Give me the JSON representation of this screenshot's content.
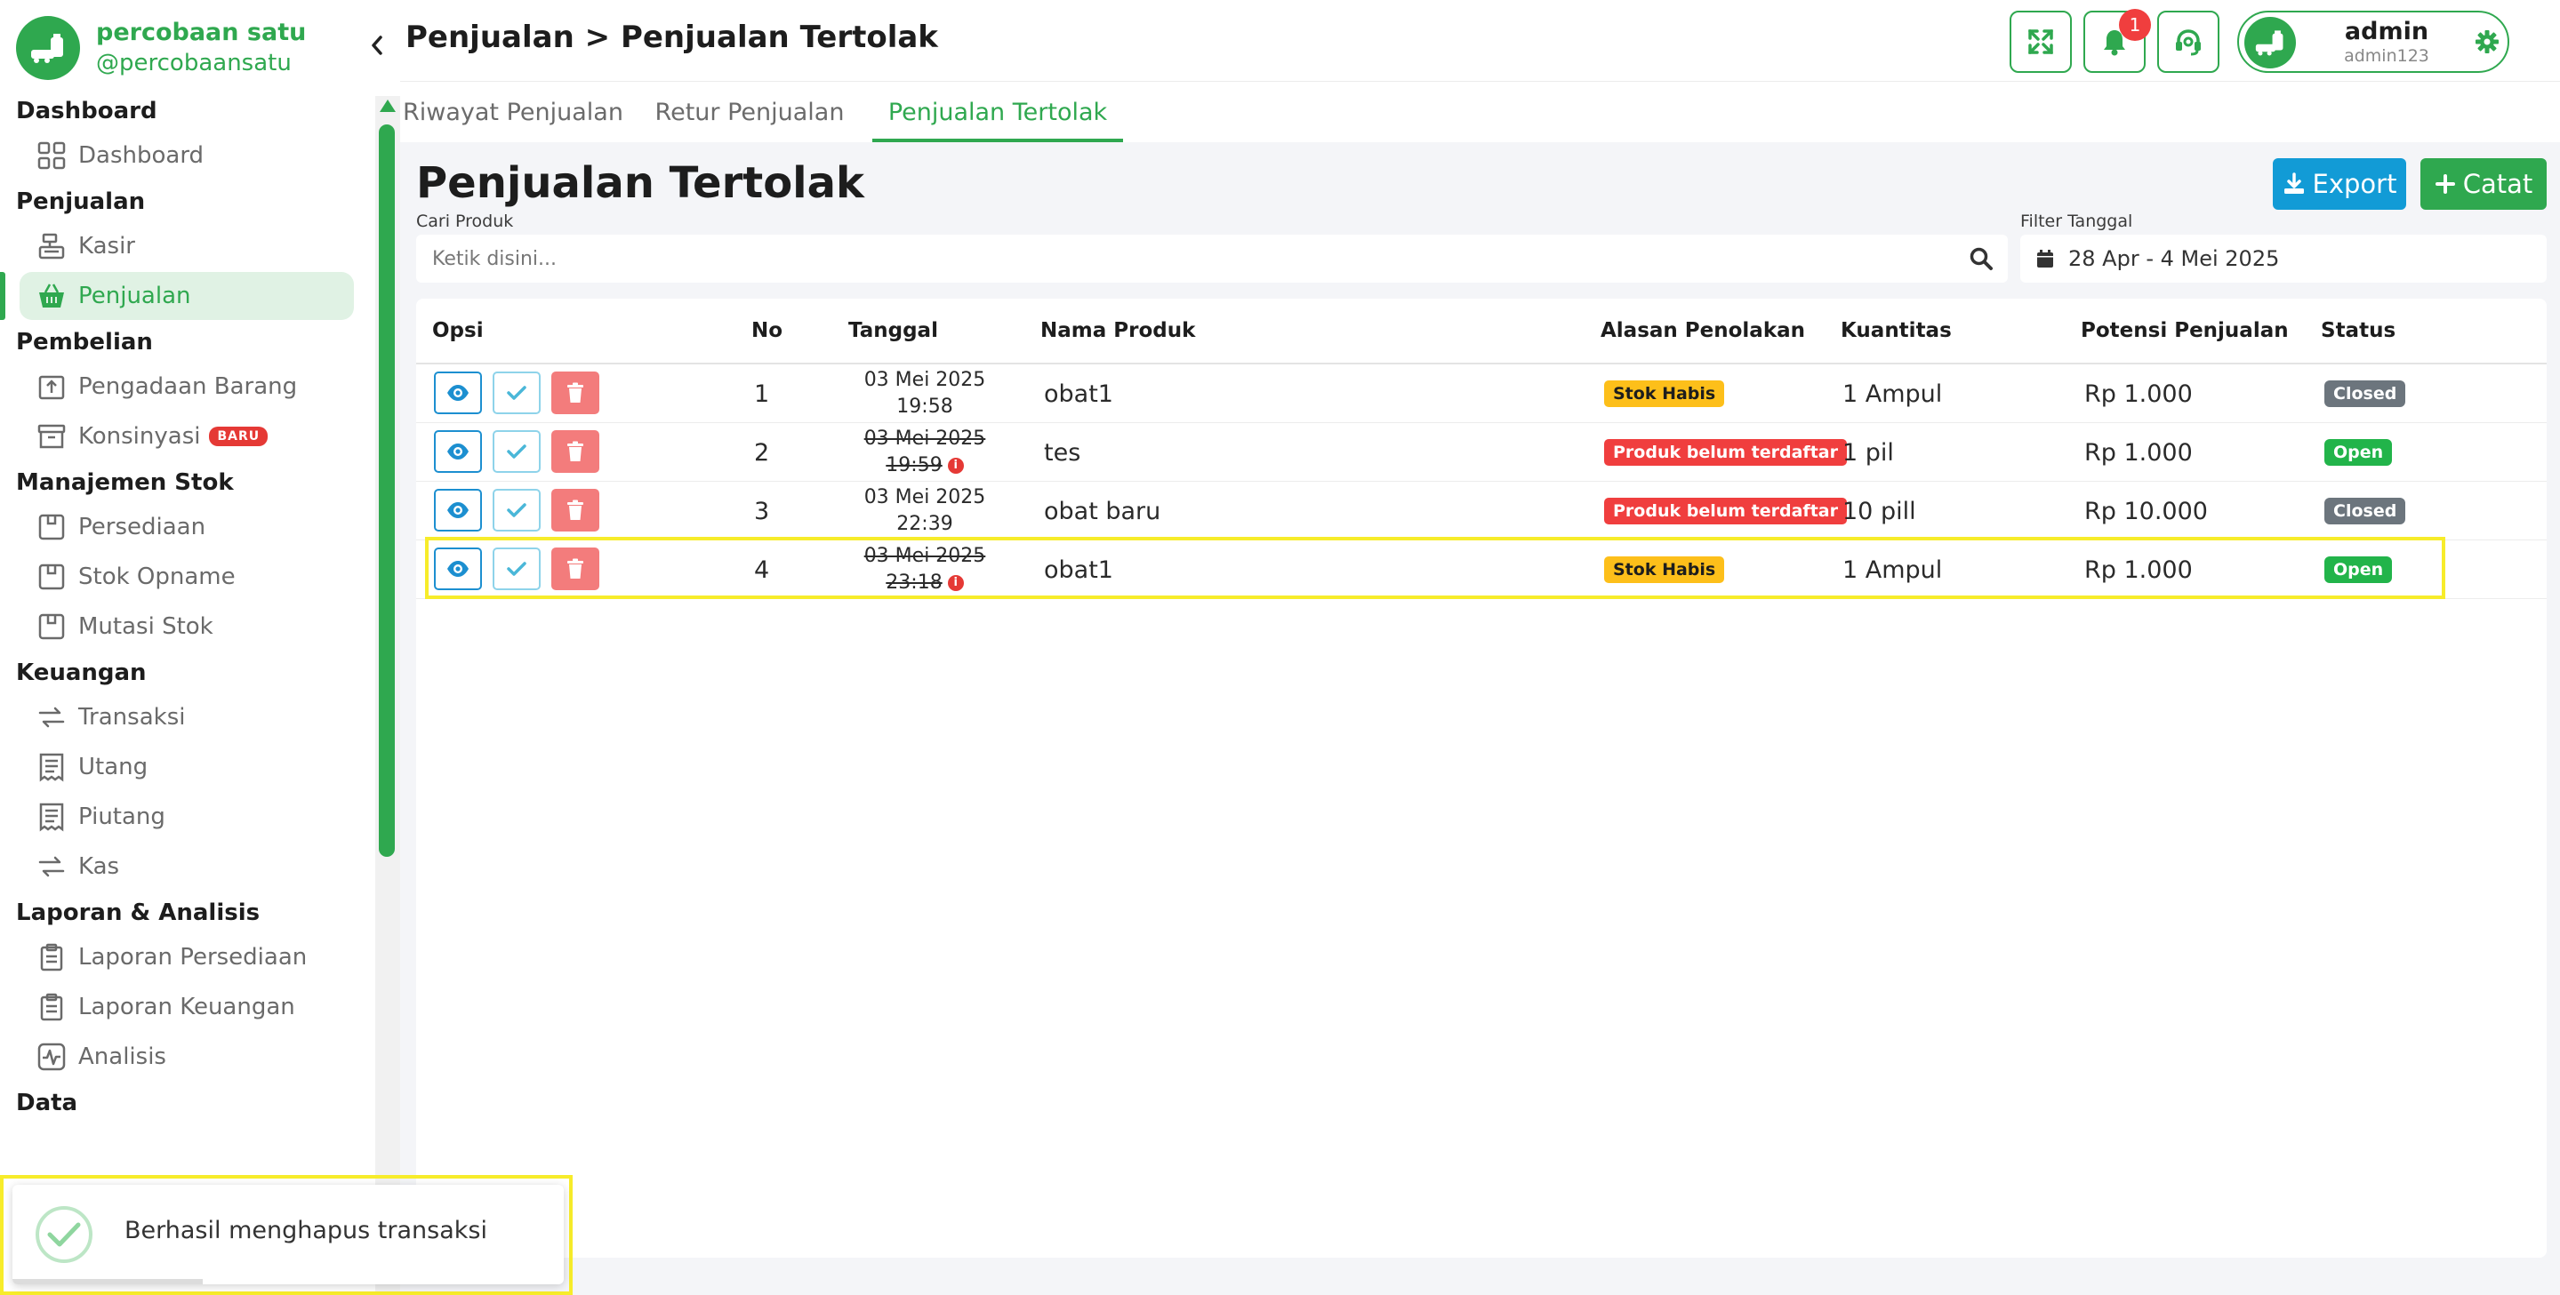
{
  "brand": {
    "name": "percobaan satu",
    "handle": "@percobaansatu"
  },
  "sidebar": {
    "sections": [
      {
        "title": "Dashboard",
        "items": [
          {
            "label": "Dashboard",
            "icon": "grid-icon"
          }
        ]
      },
      {
        "title": "Penjualan",
        "items": [
          {
            "label": "Kasir",
            "icon": "cash-register-icon"
          },
          {
            "label": "Penjualan",
            "icon": "basket-icon",
            "active": true
          }
        ]
      },
      {
        "title": "Pembelian",
        "items": [
          {
            "label": "Pengadaan Barang",
            "icon": "upload-box-icon"
          },
          {
            "label": "Konsinyasi",
            "icon": "archive-icon",
            "badge": "BARU"
          }
        ]
      },
      {
        "title": "Manajemen Stok",
        "items": [
          {
            "label": "Persediaan",
            "icon": "box-icon"
          },
          {
            "label": "Stok Opname",
            "icon": "box-icon"
          },
          {
            "label": "Mutasi Stok",
            "icon": "box-icon"
          }
        ]
      },
      {
        "title": "Keuangan",
        "items": [
          {
            "label": "Transaksi",
            "icon": "exchange-icon"
          },
          {
            "label": "Utang",
            "icon": "receipt-icon"
          },
          {
            "label": "Piutang",
            "icon": "receipt-icon"
          },
          {
            "label": "Kas",
            "icon": "exchange-icon"
          }
        ]
      },
      {
        "title": "Laporan & Analisis",
        "items": [
          {
            "label": "Laporan Persediaan",
            "icon": "clipboard-icon"
          },
          {
            "label": "Laporan Keuangan",
            "icon": "clipboard-icon"
          },
          {
            "label": "Analisis",
            "icon": "pulse-icon"
          }
        ]
      },
      {
        "title": "Data",
        "items": []
      }
    ]
  },
  "header": {
    "breadcrumb": "Penjualan > Penjualan Tertolak",
    "notif_count": "1",
    "user": {
      "name": "admin",
      "role": "admin123"
    }
  },
  "tabs": [
    {
      "label": "Riwayat Penjualan"
    },
    {
      "label": "Retur Penjualan"
    },
    {
      "label": "Penjualan Tertolak",
      "active": true
    }
  ],
  "page": {
    "title": "Penjualan Tertolak",
    "export_label": "Export",
    "catat_label": "Catat",
    "search_label": "Cari Produk",
    "search_placeholder": "Ketik disini...",
    "filter_label": "Filter Tanggal",
    "filter_value": "28 Apr - 4 Mei 2025"
  },
  "table": {
    "headers": [
      "Opsi",
      "No",
      "Tanggal",
      "Nama Produk",
      "Alasan Penolakan",
      "Kuantitas",
      "Potensi Penjualan",
      "Status"
    ],
    "rows": [
      {
        "no": "1",
        "date": "03 Mei 2025",
        "time": "19:58",
        "struck": false,
        "product": "obat1",
        "reason": "Stok Habis",
        "reason_type": "warn",
        "qty": "1 Ampul",
        "potential": "Rp 1.000",
        "status": "Closed"
      },
      {
        "no": "2",
        "date": "03 Mei 2025",
        "time": "19:59",
        "struck": true,
        "product": "tes",
        "reason": "Produk belum terdaftar",
        "reason_type": "danger",
        "qty": "1 pil",
        "potential": "Rp 1.000",
        "status": "Open"
      },
      {
        "no": "3",
        "date": "03 Mei 2025",
        "time": "22:39",
        "struck": false,
        "product": "obat baru",
        "reason": "Produk belum terdaftar",
        "reason_type": "danger",
        "qty": "10 pill",
        "potential": "Rp 10.000",
        "status": "Closed"
      },
      {
        "no": "4",
        "date": "03 Mei 2025",
        "time": "23:18",
        "struck": true,
        "product": "obat1",
        "reason": "Stok Habis",
        "reason_type": "warn",
        "qty": "1 Ampul",
        "potential": "Rp 1.000",
        "status": "Open"
      }
    ]
  },
  "toast": {
    "message": "Berhasil menghapus transaksi",
    "icon": "check-circle-icon"
  },
  "colors": {
    "primary": "#2fa84f",
    "info": "#129bd6",
    "danger": "#f03e3e",
    "warning": "#fdbf1a",
    "highlight": "#f7ec2a"
  }
}
